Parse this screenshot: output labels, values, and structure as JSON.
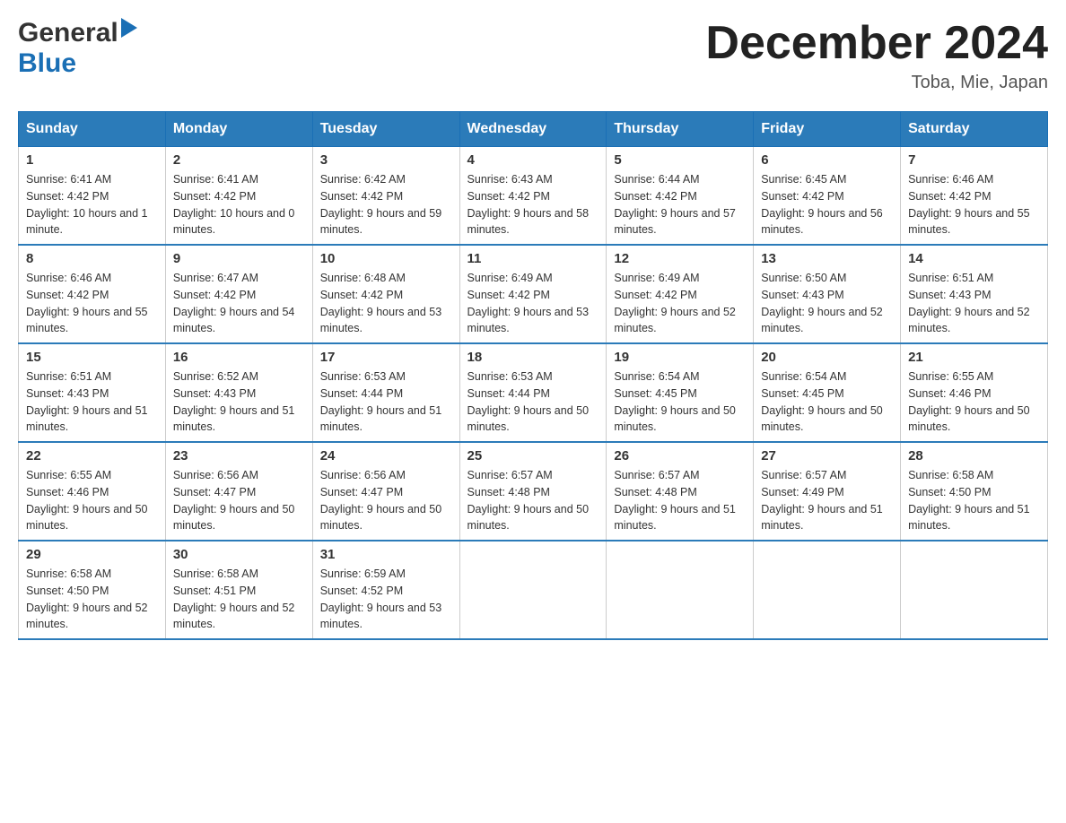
{
  "header": {
    "logo_general": "General",
    "logo_blue": "Blue",
    "month_title": "December 2024",
    "location": "Toba, Mie, Japan"
  },
  "weekdays": [
    "Sunday",
    "Monday",
    "Tuesday",
    "Wednesday",
    "Thursday",
    "Friday",
    "Saturday"
  ],
  "weeks": [
    [
      {
        "day": "1",
        "sunrise": "6:41 AM",
        "sunset": "4:42 PM",
        "daylight": "10 hours and 1 minute."
      },
      {
        "day": "2",
        "sunrise": "6:41 AM",
        "sunset": "4:42 PM",
        "daylight": "10 hours and 0 minutes."
      },
      {
        "day": "3",
        "sunrise": "6:42 AM",
        "sunset": "4:42 PM",
        "daylight": "9 hours and 59 minutes."
      },
      {
        "day": "4",
        "sunrise": "6:43 AM",
        "sunset": "4:42 PM",
        "daylight": "9 hours and 58 minutes."
      },
      {
        "day": "5",
        "sunrise": "6:44 AM",
        "sunset": "4:42 PM",
        "daylight": "9 hours and 57 minutes."
      },
      {
        "day": "6",
        "sunrise": "6:45 AM",
        "sunset": "4:42 PM",
        "daylight": "9 hours and 56 minutes."
      },
      {
        "day": "7",
        "sunrise": "6:46 AM",
        "sunset": "4:42 PM",
        "daylight": "9 hours and 55 minutes."
      }
    ],
    [
      {
        "day": "8",
        "sunrise": "6:46 AM",
        "sunset": "4:42 PM",
        "daylight": "9 hours and 55 minutes."
      },
      {
        "day": "9",
        "sunrise": "6:47 AM",
        "sunset": "4:42 PM",
        "daylight": "9 hours and 54 minutes."
      },
      {
        "day": "10",
        "sunrise": "6:48 AM",
        "sunset": "4:42 PM",
        "daylight": "9 hours and 53 minutes."
      },
      {
        "day": "11",
        "sunrise": "6:49 AM",
        "sunset": "4:42 PM",
        "daylight": "9 hours and 53 minutes."
      },
      {
        "day": "12",
        "sunrise": "6:49 AM",
        "sunset": "4:42 PM",
        "daylight": "9 hours and 52 minutes."
      },
      {
        "day": "13",
        "sunrise": "6:50 AM",
        "sunset": "4:43 PM",
        "daylight": "9 hours and 52 minutes."
      },
      {
        "day": "14",
        "sunrise": "6:51 AM",
        "sunset": "4:43 PM",
        "daylight": "9 hours and 52 minutes."
      }
    ],
    [
      {
        "day": "15",
        "sunrise": "6:51 AM",
        "sunset": "4:43 PM",
        "daylight": "9 hours and 51 minutes."
      },
      {
        "day": "16",
        "sunrise": "6:52 AM",
        "sunset": "4:43 PM",
        "daylight": "9 hours and 51 minutes."
      },
      {
        "day": "17",
        "sunrise": "6:53 AM",
        "sunset": "4:44 PM",
        "daylight": "9 hours and 51 minutes."
      },
      {
        "day": "18",
        "sunrise": "6:53 AM",
        "sunset": "4:44 PM",
        "daylight": "9 hours and 50 minutes."
      },
      {
        "day": "19",
        "sunrise": "6:54 AM",
        "sunset": "4:45 PM",
        "daylight": "9 hours and 50 minutes."
      },
      {
        "day": "20",
        "sunrise": "6:54 AM",
        "sunset": "4:45 PM",
        "daylight": "9 hours and 50 minutes."
      },
      {
        "day": "21",
        "sunrise": "6:55 AM",
        "sunset": "4:46 PM",
        "daylight": "9 hours and 50 minutes."
      }
    ],
    [
      {
        "day": "22",
        "sunrise": "6:55 AM",
        "sunset": "4:46 PM",
        "daylight": "9 hours and 50 minutes."
      },
      {
        "day": "23",
        "sunrise": "6:56 AM",
        "sunset": "4:47 PM",
        "daylight": "9 hours and 50 minutes."
      },
      {
        "day": "24",
        "sunrise": "6:56 AM",
        "sunset": "4:47 PM",
        "daylight": "9 hours and 50 minutes."
      },
      {
        "day": "25",
        "sunrise": "6:57 AM",
        "sunset": "4:48 PM",
        "daylight": "9 hours and 50 minutes."
      },
      {
        "day": "26",
        "sunrise": "6:57 AM",
        "sunset": "4:48 PM",
        "daylight": "9 hours and 51 minutes."
      },
      {
        "day": "27",
        "sunrise": "6:57 AM",
        "sunset": "4:49 PM",
        "daylight": "9 hours and 51 minutes."
      },
      {
        "day": "28",
        "sunrise": "6:58 AM",
        "sunset": "4:50 PM",
        "daylight": "9 hours and 51 minutes."
      }
    ],
    [
      {
        "day": "29",
        "sunrise": "6:58 AM",
        "sunset": "4:50 PM",
        "daylight": "9 hours and 52 minutes."
      },
      {
        "day": "30",
        "sunrise": "6:58 AM",
        "sunset": "4:51 PM",
        "daylight": "9 hours and 52 minutes."
      },
      {
        "day": "31",
        "sunrise": "6:59 AM",
        "sunset": "4:52 PM",
        "daylight": "9 hours and 53 minutes."
      },
      null,
      null,
      null,
      null
    ]
  ],
  "labels": {
    "sunrise": "Sunrise:",
    "sunset": "Sunset:",
    "daylight": "Daylight:"
  }
}
